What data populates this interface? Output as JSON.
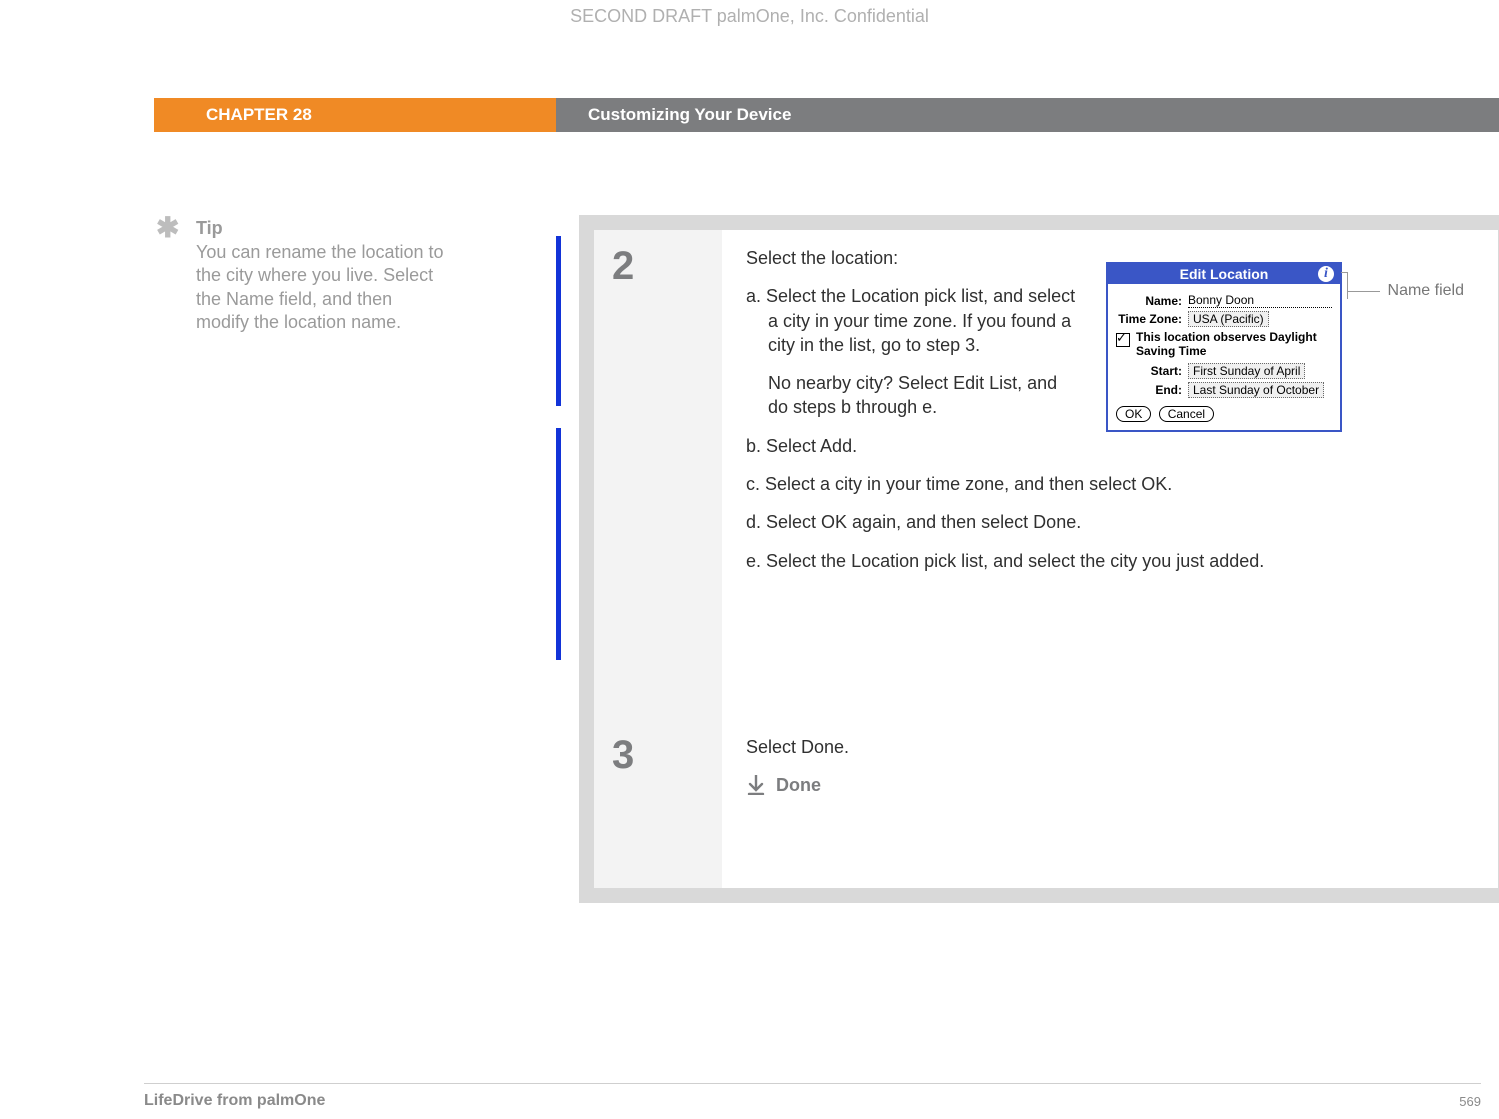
{
  "watermark": "SECOND DRAFT palmOne, Inc.  Confidential",
  "header": {
    "chapter": "CHAPTER 28",
    "title": "Customizing Your Device"
  },
  "tip": {
    "heading": "Tip",
    "body": "You can rename the location to the city where you live. Select the Name field, and then modify the location name."
  },
  "steps": {
    "two": {
      "num": "2",
      "lead": "Select the location:",
      "a": "a.  Select the Location pick list, and select a city in your time zone. If you found a city in the list, go to step 3.",
      "a2": "No nearby city? Select Edit List, and do steps b through e.",
      "b": "b.  Select Add.",
      "c": "c.  Select a city in your time zone, and then select OK.",
      "d": "d.  Select OK again, and then select Done.",
      "e": "e.  Select the Location pick list, and select the city you just added."
    },
    "three": {
      "num": "3",
      "lead": "Select Done.",
      "done": "Done"
    }
  },
  "palm": {
    "title": "Edit Location",
    "name_label": "Name:",
    "name_value": "Bonny Doon",
    "tz_label": "Time Zone:",
    "tz_value": "USA (Pacific)",
    "dst_label": "This location observes Daylight Saving Time",
    "start_label": "Start:",
    "start_value": "First Sunday of April",
    "end_label": "End:",
    "end_value": "Last Sunday of October",
    "ok": "OK",
    "cancel": "Cancel"
  },
  "callout": "Name field",
  "footer": {
    "left": "LifeDrive from palmOne",
    "right": "569"
  }
}
